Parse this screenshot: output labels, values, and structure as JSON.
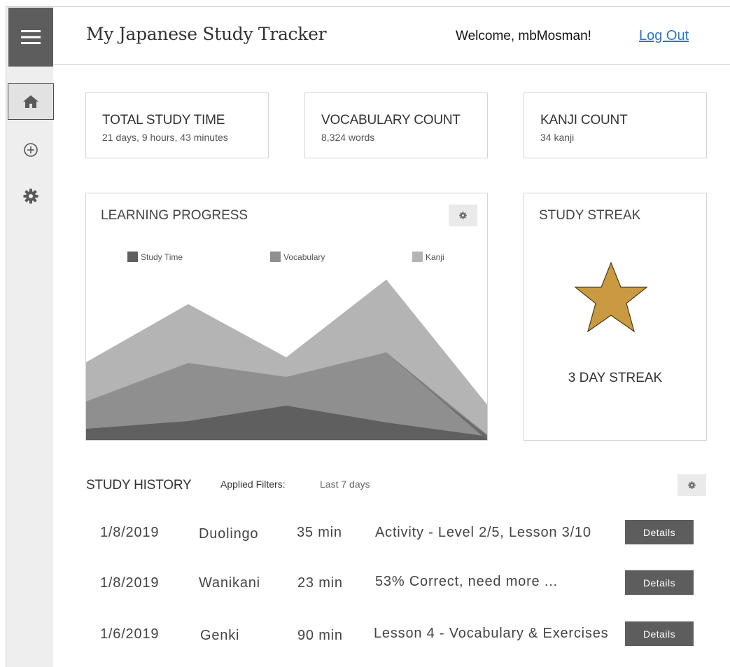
{
  "header": {
    "title": "My Japanese Study Tracker",
    "welcome": "Welcome, mbMosman!",
    "logout": "Log Out"
  },
  "sidebar": {
    "items": [
      {
        "icon": "menu-icon"
      },
      {
        "icon": "home-icon",
        "active": true
      },
      {
        "icon": "add-circle-icon"
      },
      {
        "icon": "gear-icon"
      }
    ]
  },
  "stats": [
    {
      "title": "TOTAL STUDY TIME",
      "value": "21 days, 9 hours, 43 minutes"
    },
    {
      "title": "VOCABULARY COUNT",
      "value": "8,324 words"
    },
    {
      "title": "KANJI COUNT",
      "value": "34 kanji"
    }
  ],
  "progress": {
    "title": "LEARNING PROGRESS",
    "legend": [
      {
        "label": "Study Time",
        "color": "#5f5f5f"
      },
      {
        "label": "Vocabulary",
        "color": "#8f8f8f"
      },
      {
        "label": "Kanji",
        "color": "#b4b4b4"
      }
    ]
  },
  "streak": {
    "title": "STUDY STREAK",
    "label": "3 DAY STREAK",
    "star_color": "#c99a42"
  },
  "history": {
    "title": "STUDY HISTORY",
    "filters_label": "Applied Filters:",
    "filters_value": "Last 7 days",
    "details_label": "Details",
    "rows": [
      {
        "date": "1/8/2019",
        "source": "Duolingo",
        "duration": "35 min",
        "note": "Activity - Level 2/5, Lesson 3/10"
      },
      {
        "date": "1/8/2019",
        "source": "Wanikani",
        "duration": "23 min",
        "note": "53% Correct, need more ..."
      },
      {
        "date": "1/6/2019",
        "source": "Genki",
        "duration": "90 min",
        "note": "Lesson 4 - Vocabulary & Exercises"
      }
    ]
  }
}
